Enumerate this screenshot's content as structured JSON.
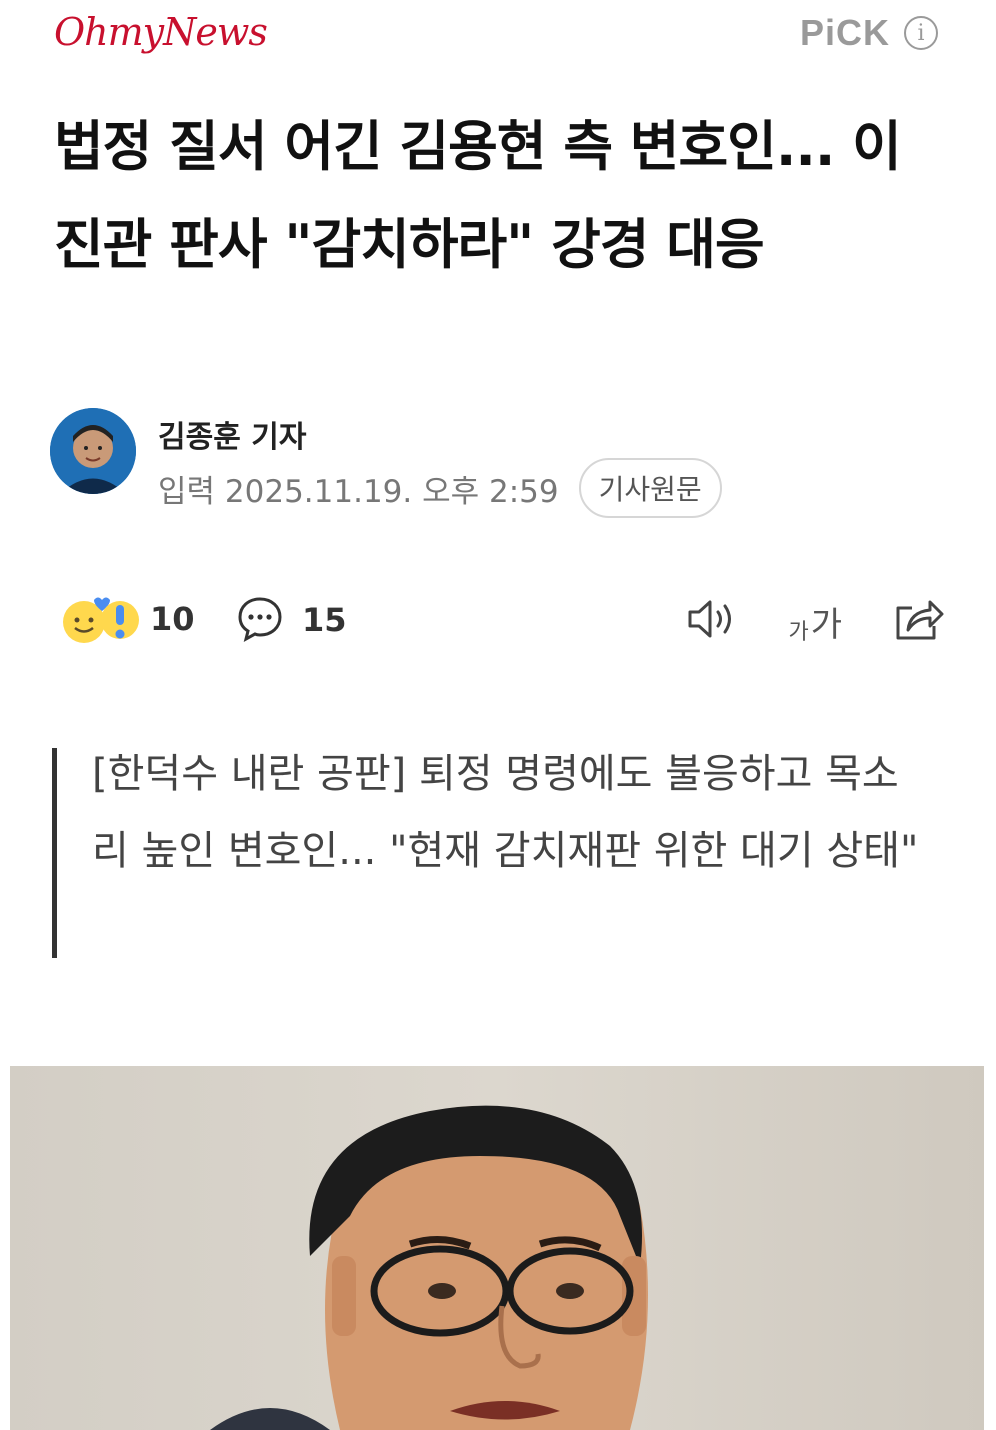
{
  "header": {
    "logo": "OhmyNews",
    "pick_label": "PiCK",
    "info_icon": "info-icon"
  },
  "article": {
    "title": "법정 질서 어긴 김용현 측 변호인... 이진관 판사 \"감치하라\" 강경 대응",
    "author": "김종훈 기자",
    "published": "입력 2025.11.19. 오후 2:59",
    "original_button": "기사원문",
    "summary": "[한덕수 내란 공판] 퇴정 명령에도 불응하고 목소리 높인 변호인... \"현재 감치재판 위한 대기 상태\""
  },
  "actions": {
    "reaction_count": "10",
    "comment_count": "15",
    "font_size_label_small": "가",
    "font_size_label_large": "가",
    "icons": [
      "reaction-emoji-icon",
      "comment-icon",
      "speaker-icon",
      "font-size-icon",
      "share-icon"
    ]
  },
  "colors": {
    "brand": "#c8102e",
    "pick_gray": "#9a9a9a",
    "text": "#111111",
    "meta": "#777777"
  }
}
